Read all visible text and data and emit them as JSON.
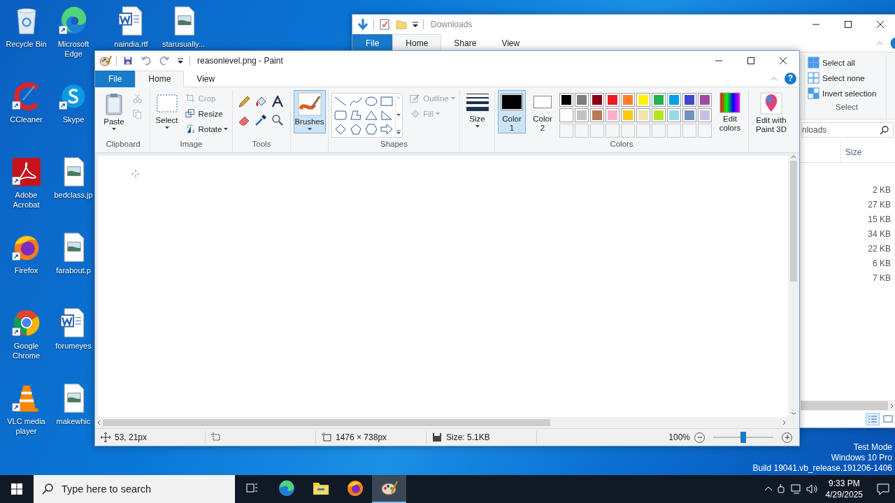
{
  "desktop": {
    "icon_columns": [
      [
        {
          "label": "Recycle Bin",
          "kind": "recycle",
          "shortcut": false
        },
        {
          "label": "CCleaner",
          "kind": "ccleaner",
          "shortcut": true
        },
        {
          "label": "Adobe Acrobat",
          "kind": "acrobat",
          "shortcut": true
        },
        {
          "label": "Firefox",
          "kind": "firefox",
          "shortcut": true
        },
        {
          "label": "Google Chrome",
          "kind": "chrome",
          "shortcut": true
        },
        {
          "label": "VLC media player",
          "kind": "vlc",
          "shortcut": true
        }
      ],
      [
        {
          "label": "Microsoft Edge",
          "kind": "edge",
          "shortcut": true
        },
        {
          "label": "Skype",
          "kind": "skype",
          "shortcut": true
        },
        {
          "label": "bedclass.jp",
          "kind": "image",
          "shortcut": false
        },
        {
          "label": "farabout.p",
          "kind": "image",
          "shortcut": false
        },
        {
          "label": "forumeyes",
          "kind": "word",
          "shortcut": false
        },
        {
          "label": "makewhic",
          "kind": "image",
          "shortcut": false
        }
      ],
      [
        {
          "label": "naindia.rtf",
          "kind": "word",
          "shortcut": false
        }
      ],
      [
        {
          "label": "starusually...",
          "kind": "image",
          "shortcut": false
        }
      ]
    ],
    "os_info": [
      "Test Mode",
      "Windows 10 Pro",
      "Build 19041.vb_release.191206-1406"
    ]
  },
  "explorer": {
    "title": "Downloads",
    "tabs": [
      {
        "label": "File",
        "kind": "file",
        "selected": false
      },
      {
        "label": "Home",
        "kind": "tab",
        "selected": true
      },
      {
        "label": "Share",
        "kind": "tab",
        "selected": false
      },
      {
        "label": "View",
        "kind": "tab",
        "selected": false
      }
    ],
    "select_group": {
      "label": "Select",
      "items": [
        {
          "label": "Select all",
          "kind": "all"
        },
        {
          "label": "Select none",
          "kind": "none"
        },
        {
          "label": "Invert selection",
          "kind": "invert"
        }
      ]
    },
    "search": {
      "value": "nloads"
    },
    "columns": [
      "Size"
    ],
    "sizes": [
      "2 KB",
      "27 KB",
      "15 KB",
      "34 KB",
      "22 KB",
      "6 KB",
      "7 KB"
    ]
  },
  "paint": {
    "title": "reasonlevel.png - Paint",
    "tabs": [
      {
        "label": "File",
        "kind": "file",
        "selected": false
      },
      {
        "label": "Home",
        "kind": "tab",
        "selected": true
      },
      {
        "label": "View",
        "kind": "tab",
        "selected": false
      }
    ],
    "help": "?",
    "clipboard": {
      "label": "Clipboard",
      "paste": "Paste",
      "cut": {
        "disabled": true
      },
      "copy": {
        "disabled": true
      }
    },
    "image": {
      "label": "Image",
      "select": "Select",
      "actions": [
        {
          "label": "Crop",
          "kind": "crop",
          "disabled": true,
          "dropdown": false
        },
        {
          "label": "Resize",
          "kind": "resize",
          "disabled": false,
          "dropdown": false
        },
        {
          "label": "Rotate",
          "kind": "rotate",
          "disabled": false,
          "dropdown": true
        }
      ]
    },
    "tools": {
      "label": "Tools"
    },
    "brushes": {
      "label": "Brushes",
      "selected": true
    },
    "shapes": {
      "label": "Shapes",
      "outline": {
        "label": "Outline",
        "disabled": true
      },
      "fill": {
        "label": "Fill",
        "disabled": true
      }
    },
    "size": {
      "label": "Size"
    },
    "colors": {
      "label": "Colors",
      "edit": "Edit colors",
      "slots": [
        {
          "label": "Color 1",
          "color": "#000000",
          "selected": true
        },
        {
          "label": "Color 2",
          "color": "#ffffff",
          "selected": false
        }
      ],
      "palette": [
        {
          "color": "#000000"
        },
        {
          "color": "#7f7f7f"
        },
        {
          "color": "#880015"
        },
        {
          "color": "#ed1c24"
        },
        {
          "color": "#ff7f27"
        },
        {
          "color": "#fff200"
        },
        {
          "color": "#22b14c"
        },
        {
          "color": "#00a2e8"
        },
        {
          "color": "#3f48cc"
        },
        {
          "color": "#a349a4"
        },
        {
          "color": "#ffffff"
        },
        {
          "color": "#c3c3c3"
        },
        {
          "color": "#b97a57"
        },
        {
          "color": "#ffaec9"
        },
        {
          "color": "#ffc90e"
        },
        {
          "color": "#efe4b0"
        },
        {
          "color": "#b5e61d"
        },
        {
          "color": "#99d9ea"
        },
        {
          "color": "#7092be"
        },
        {
          "color": "#c8bfe7"
        }
      ],
      "empty_slots": [
        {
          "kind": "empty"
        },
        {
          "kind": "empty"
        },
        {
          "kind": "empty"
        },
        {
          "kind": "empty"
        },
        {
          "kind": "empty"
        },
        {
          "kind": "empty"
        },
        {
          "kind": "empty"
        },
        {
          "kind": "empty"
        },
        {
          "kind": "empty"
        },
        {
          "kind": "empty"
        }
      ]
    },
    "paint3d": {
      "label": "Edit with Paint 3D"
    },
    "status": {
      "position": "53, 21px",
      "dimensions": "1476 × 738px",
      "file_size": "Size: 5.1KB",
      "zoom": "100%",
      "zoom_level": {
        "level": 0.5
      }
    }
  },
  "taskbar": {
    "search": {
      "placeholder": "Type here to search"
    },
    "apps": [
      {
        "kind": "taskview",
        "selected": false
      },
      {
        "kind": "edge",
        "selected": false
      },
      {
        "kind": "explorer",
        "selected": false
      },
      {
        "kind": "firefox",
        "selected": false
      },
      {
        "kind": "paint",
        "selected": true
      }
    ],
    "time": "9:33 PM",
    "date": "4/29/2025"
  }
}
